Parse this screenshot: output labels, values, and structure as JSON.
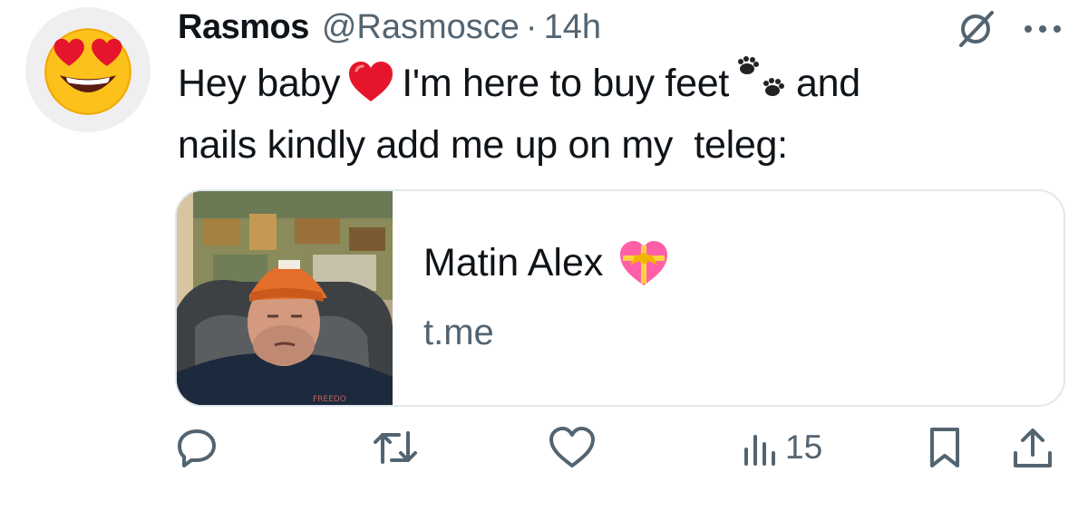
{
  "tweet": {
    "author_name": "Rasmos",
    "handle": "@Rasmosce",
    "separator": "·",
    "time": "14h",
    "text_parts": [
      "Hey baby",
      "I'm here to buy feet",
      "and",
      "nails kindly add me up on my  teleg:"
    ],
    "avatar_icon": "heart-eyes-emoji-icon",
    "inline_emoji": [
      "red-heart-emoji",
      "paw-prints-emoji"
    ]
  },
  "link_card": {
    "title": "Matin Alex",
    "title_emoji": "heart-with-ribbon-emoji",
    "domain": "t.me",
    "image": "selfie-photo-man-orange-cap"
  },
  "actions": {
    "reply_icon": "reply-icon",
    "retweet_icon": "retweet-icon",
    "like_icon": "heart-icon",
    "views_icon": "views-icon",
    "views_count": "15",
    "bookmark_icon": "bookmark-icon",
    "share_icon": "share-icon"
  },
  "colors": {
    "text_primary": "#0f1419",
    "text_secondary": "#536471",
    "border": "#e1e8ed"
  }
}
